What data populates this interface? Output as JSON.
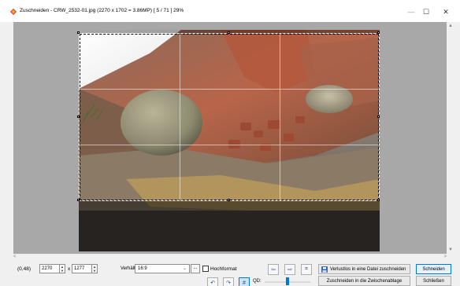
{
  "window": {
    "title": "Zuschneiden  -  CRW_2532-01.jpg  (2270 x 1702 = 3.86MP)  [ 5 / 71 ]  29%",
    "minimize_glyph": "—",
    "maximize_glyph": "☐",
    "close_glyph": "✕"
  },
  "toolbar": {
    "coords": "(0,48)",
    "width_value": "2270",
    "height_value": "1277",
    "times": "x",
    "ratio_label": "Verhältnis:",
    "ratio_value": "16:9",
    "dots_label": "...",
    "portrait_label": "Hochformat",
    "prev_glyph": "⇦",
    "next_glyph": "⇨",
    "fit_glyph": "⌗",
    "lossless_label": "Verlustlos in eine Datei zuschneiden",
    "crop_label": "Schneiden",
    "rotate_left_glyph": "↶",
    "rotate_right_glyph": "↷",
    "grid_glyph": "#",
    "qd_label": "QD:",
    "clipboard_label": "Zuschneiden in die Zwischenablage",
    "close_label": "Schließen"
  },
  "scrollbars": {
    "up": "▲",
    "down": "▼",
    "left": "<",
    "right": ">"
  },
  "qd_slider_fraction": 0.5
}
